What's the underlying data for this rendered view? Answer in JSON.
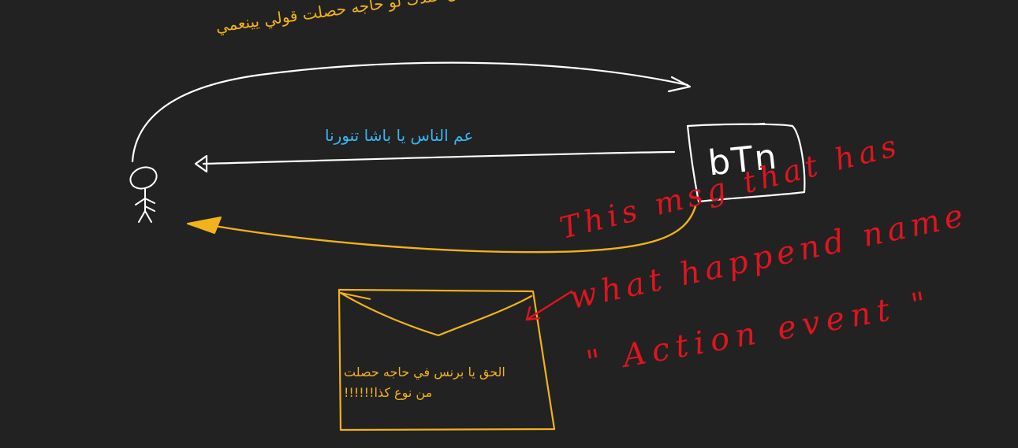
{
  "labels": {
    "top_arrow": "هسجل عندك لو حاجه حصلت قولي يينعمي",
    "middle_arrow": "عم الناس يا باشا تنورنا"
  },
  "button": {
    "text": "bTn"
  },
  "envelope": {
    "line1": "الحق يا برنس في حاجه حصلت",
    "line2": "من نوع كذا!!!!!!"
  },
  "annotation": {
    "line1": "This msg that has",
    "line2": "what happend name",
    "line3": "\" Action event \""
  },
  "colors": {
    "background": "#222222",
    "white_ink": "#ffffff",
    "yellow_ink": "#f2b21b",
    "blue_text": "#37b6f0",
    "red_ink": "#e0141e"
  }
}
